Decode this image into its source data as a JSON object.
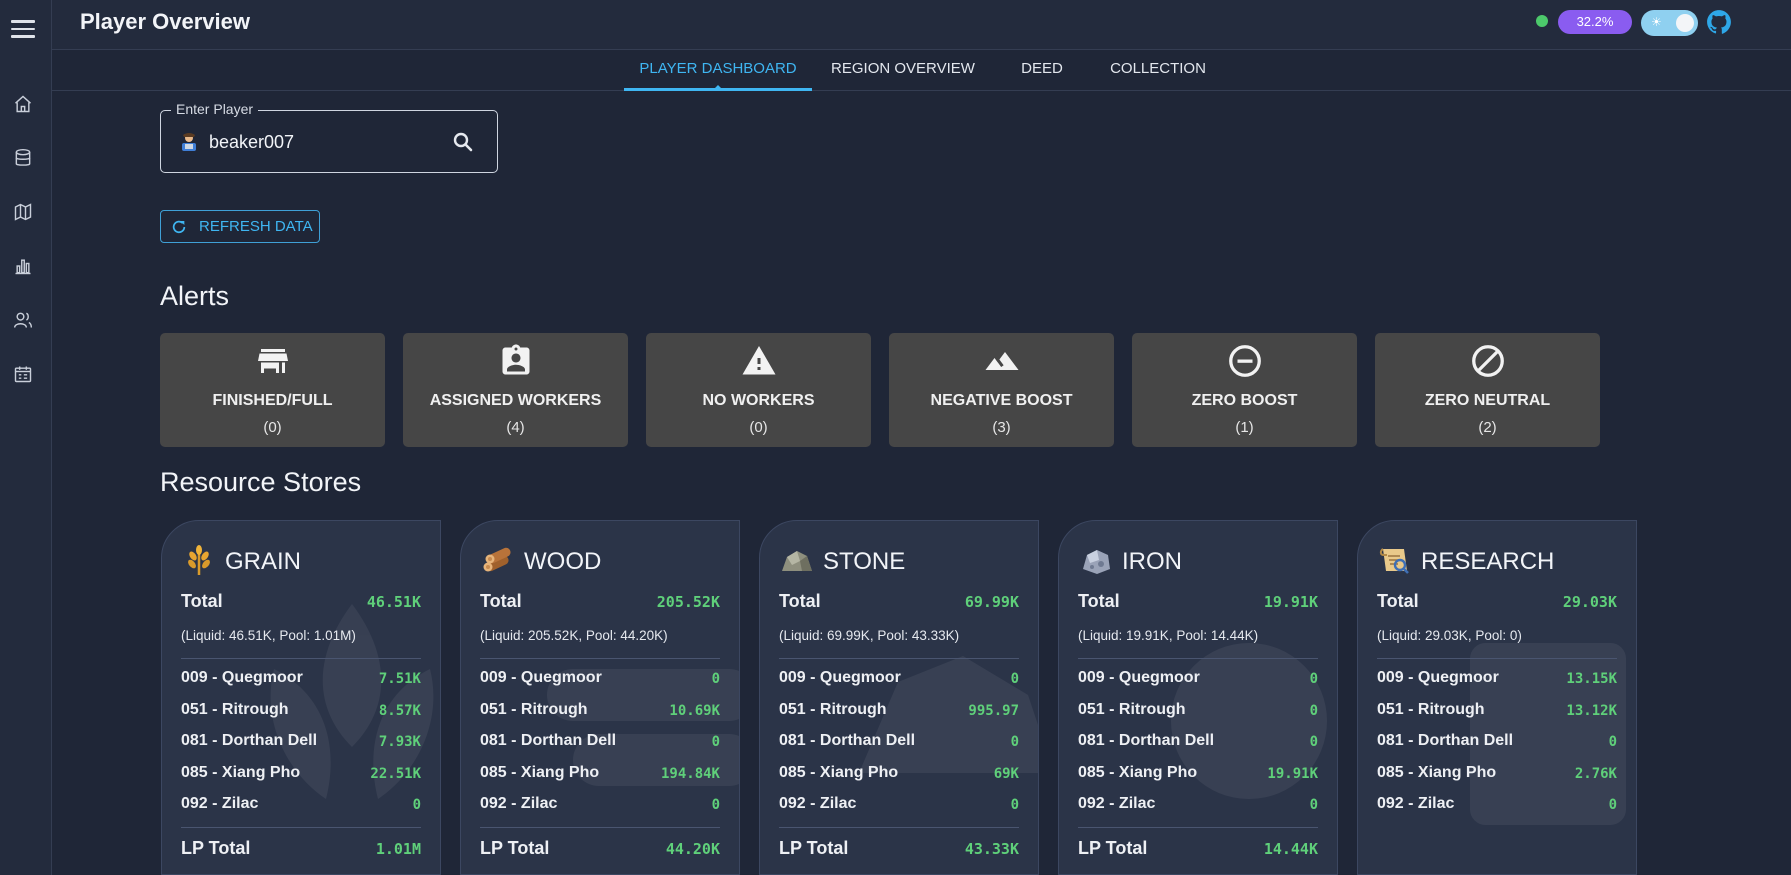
{
  "header": {
    "title": "Player Overview",
    "percent_badge": "32.2%"
  },
  "tabs": [
    {
      "label": "PLAYER DASHBOARD",
      "active": true
    },
    {
      "label": "REGION OVERVIEW",
      "active": false
    },
    {
      "label": "DEED",
      "active": false
    },
    {
      "label": "COLLECTION",
      "active": false
    }
  ],
  "player": {
    "legend": "Enter Player",
    "value": "beaker007"
  },
  "refresh_label": "REFRESH DATA",
  "alerts_title": "Alerts",
  "alerts": [
    {
      "label": "FINISHED/FULL",
      "count": "(0)",
      "icon": "store-icon"
    },
    {
      "label": "ASSIGNED WORKERS",
      "count": "(4)",
      "icon": "assigned-badge-icon"
    },
    {
      "label": "NO WORKERS",
      "count": "(0)",
      "icon": "warning-icon"
    },
    {
      "label": "NEGATIVE BOOST",
      "count": "(3)",
      "icon": "terrain-icon"
    },
    {
      "label": "ZERO BOOST",
      "count": "(1)",
      "icon": "minus-circle-icon"
    },
    {
      "label": "ZERO NEUTRAL",
      "count": "(2)",
      "icon": "block-icon"
    }
  ],
  "resources_title": "Resource Stores",
  "resources": [
    {
      "name": "GRAIN",
      "icon": "grain-icon",
      "total_label": "Total",
      "total": "46.51K",
      "breakdown": "(Liquid: 46.51K, Pool: 1.01M)",
      "regions": [
        {
          "name": "009 - Quegmoor",
          "value": "7.51K"
        },
        {
          "name": "051 - Ritrough",
          "value": "8.57K"
        },
        {
          "name": "081 - Dorthan Dell",
          "value": "7.93K"
        },
        {
          "name": "085 - Xiang Pho",
          "value": "22.51K"
        },
        {
          "name": "092 - Zilac",
          "value": "0"
        }
      ],
      "lp_label": "LP Total",
      "lp_total": "1.01M"
    },
    {
      "name": "WOOD",
      "icon": "wood-icon",
      "total_label": "Total",
      "total": "205.52K",
      "breakdown": "(Liquid: 205.52K, Pool: 44.20K)",
      "regions": [
        {
          "name": "009 - Quegmoor",
          "value": "0"
        },
        {
          "name": "051 - Ritrough",
          "value": "10.69K"
        },
        {
          "name": "081 - Dorthan Dell",
          "value": "0"
        },
        {
          "name": "085 - Xiang Pho",
          "value": "194.84K"
        },
        {
          "name": "092 - Zilac",
          "value": "0"
        }
      ],
      "lp_label": "LP Total",
      "lp_total": "44.20K"
    },
    {
      "name": "STONE",
      "icon": "stone-icon",
      "total_label": "Total",
      "total": "69.99K",
      "breakdown": "(Liquid: 69.99K, Pool: 43.33K)",
      "regions": [
        {
          "name": "009 - Quegmoor",
          "value": "0"
        },
        {
          "name": "051 - Ritrough",
          "value": "995.97"
        },
        {
          "name": "081 - Dorthan Dell",
          "value": "0"
        },
        {
          "name": "085 - Xiang Pho",
          "value": "69K"
        },
        {
          "name": "092 - Zilac",
          "value": "0"
        }
      ],
      "lp_label": "LP Total",
      "lp_total": "43.33K"
    },
    {
      "name": "IRON",
      "icon": "iron-icon",
      "total_label": "Total",
      "total": "19.91K",
      "breakdown": "(Liquid: 19.91K, Pool: 14.44K)",
      "regions": [
        {
          "name": "009 - Quegmoor",
          "value": "0"
        },
        {
          "name": "051 - Ritrough",
          "value": "0"
        },
        {
          "name": "081 - Dorthan Dell",
          "value": "0"
        },
        {
          "name": "085 - Xiang Pho",
          "value": "19.91K"
        },
        {
          "name": "092 - Zilac",
          "value": "0"
        }
      ],
      "lp_label": "LP Total",
      "lp_total": "14.44K"
    },
    {
      "name": "RESEARCH",
      "icon": "research-icon",
      "total_label": "Total",
      "total": "29.03K",
      "breakdown": "(Liquid: 29.03K, Pool: 0)",
      "regions": [
        {
          "name": "009 - Quegmoor",
          "value": "13.15K"
        },
        {
          "name": "051 - Ritrough",
          "value": "13.12K"
        },
        {
          "name": "081 - Dorthan Dell",
          "value": "0"
        },
        {
          "name": "085 - Xiang Pho",
          "value": "2.76K"
        },
        {
          "name": "092 - Zilac",
          "value": "0"
        }
      ]
    }
  ],
  "colors": {
    "accent": "#3fb6f2",
    "value_green": "#5fd07a",
    "background": "#1f2637",
    "alert_card": "#464646",
    "badge": "#8a5cf0",
    "status_dot": "#4cc96b"
  }
}
